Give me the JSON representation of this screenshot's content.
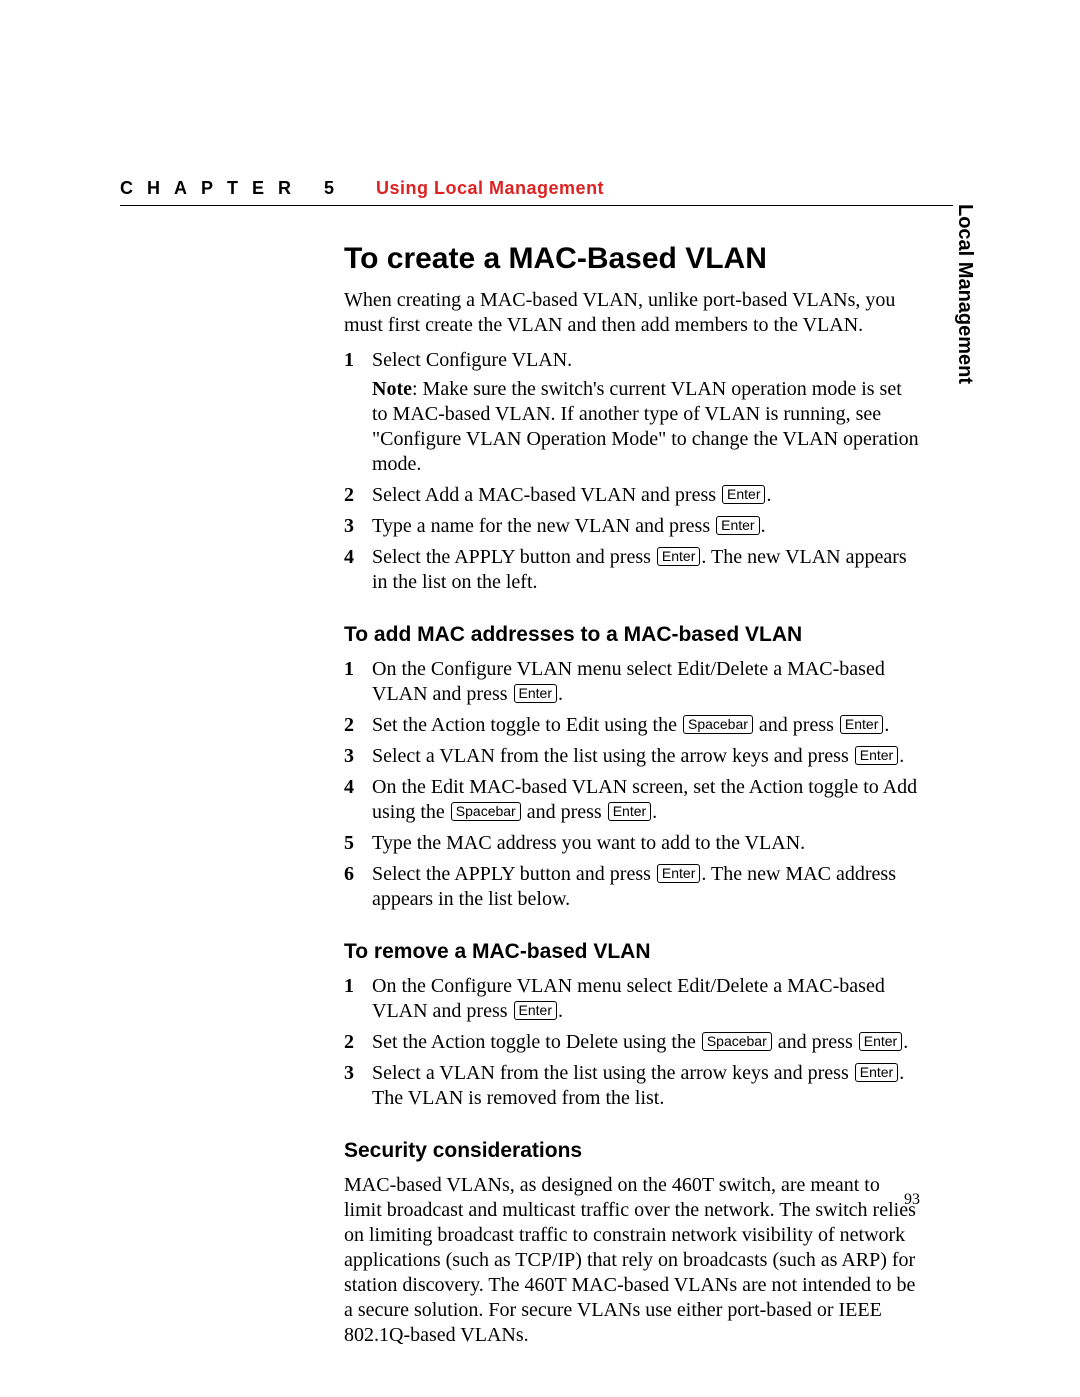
{
  "header": {
    "chapter_label": "CHAPTER 5",
    "chapter_title": "Using Local Management"
  },
  "side_tab": "Local Management",
  "page_number": "93",
  "keys": {
    "enter": "Enter",
    "spacebar": "Spacebar"
  },
  "section": {
    "title": "To create a MAC-Based VLAN",
    "intro": "When creating a MAC-based VLAN, unlike port-based VLANs, you must first create the VLAN and then add members to the VLAN.",
    "steps": {
      "s1": "Select Configure VLAN.",
      "note_label": "Note",
      "note_text": ": Make sure the switch's current VLAN operation mode is set to MAC-based VLAN. If another type of VLAN is running, see \"Configure VLAN Operation Mode\" to change the VLAN operation mode.",
      "s2a": "Select Add a MAC-based VLAN and press ",
      "s2b": ".",
      "s3a": "Type a name for the new VLAN and press ",
      "s3b": ".",
      "s4a": "Select the APPLY button and press ",
      "s4b": ". The new VLAN appears in the list on the left."
    }
  },
  "sub1": {
    "title": "To add MAC addresses to a MAC-based VLAN",
    "s1a": "On the Configure VLAN menu select Edit/Delete a MAC-based VLAN and press ",
    "s1b": ".",
    "s2a": "Set the Action toggle to Edit using the ",
    "s2b": " and press ",
    "s2c": ".",
    "s3a": "Select a VLAN from the list using the arrow keys and press ",
    "s3b": ".",
    "s4a": "On the Edit MAC-based VLAN screen, set the Action toggle to Add using the ",
    "s4b": " and press ",
    "s4c": ".",
    "s5": "Type the MAC address you want to add to the VLAN.",
    "s6a": "Select the APPLY button and press ",
    "s6b": ". The new MAC address appears in the list below."
  },
  "sub2": {
    "title": "To remove a MAC-based VLAN",
    "s1a": "On the Configure VLAN menu select Edit/Delete a MAC-based VLAN and press ",
    "s1b": ".",
    "s2a": "Set the Action toggle to Delete using the ",
    "s2b": " and press ",
    "s2c": ".",
    "s3a": "Select a VLAN from the list using the arrow keys and press ",
    "s3b": ". The VLAN is removed from the list."
  },
  "sub3": {
    "title": "Security considerations",
    "body": "MAC-based VLANs, as designed on the 460T switch, are meant to limit broadcast and multicast traffic over the network. The switch relies on limiting broadcast traffic to constrain network visibility of network applications (such as TCP/IP) that rely on broadcasts (such as ARP) for station discovery. The 460T MAC-based VLANs are not intended to be a secure solution. For secure VLANs use either port-based or IEEE 802.1Q-based VLANs."
  }
}
